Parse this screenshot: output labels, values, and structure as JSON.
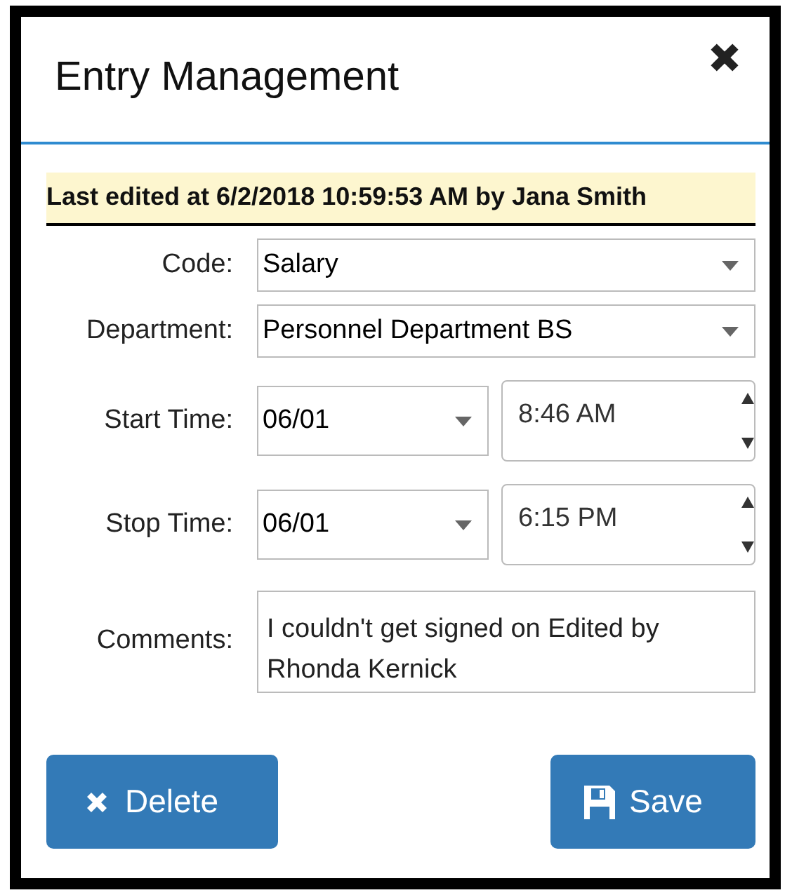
{
  "dialog": {
    "title": "Entry Management",
    "notice": "Last edited at 6/2/2018 10:59:53 AM by Jana Smith"
  },
  "fields": [
    {
      "kind": "select",
      "label": "Code:",
      "value": "Salary"
    },
    {
      "kind": "select",
      "label": "Department:",
      "value": "Personnel Department BS"
    },
    {
      "kind": "datetime",
      "label": "Start Time:",
      "date": "06/01",
      "time": "8:46 AM"
    },
    {
      "kind": "datetime",
      "label": "Stop Time:",
      "date": "06/01",
      "time": "6:15 PM"
    },
    {
      "kind": "textarea",
      "label": "Comments:",
      "value": "I couldn't get signed on  Edited by Rhonda Kernick"
    }
  ],
  "buttons": [
    {
      "kind": "delete",
      "label": "Delete"
    },
    {
      "kind": "save",
      "label": "Save"
    }
  ]
}
